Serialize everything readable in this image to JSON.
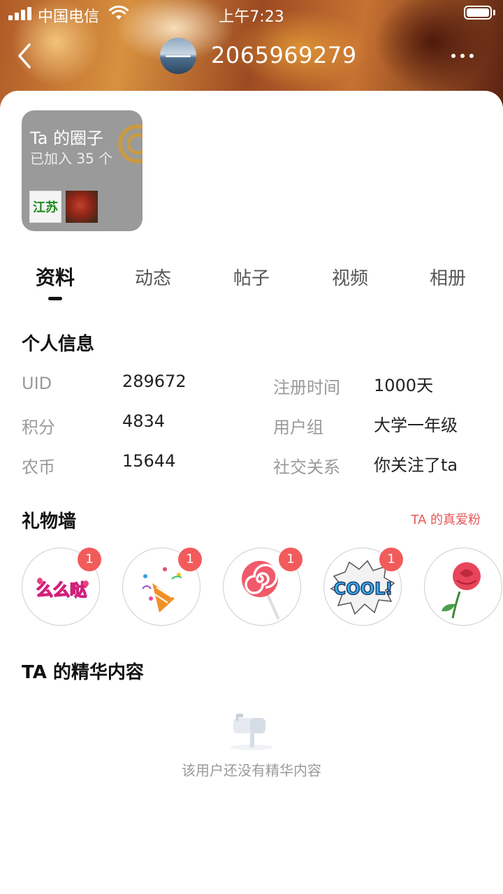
{
  "status_bar": {
    "carrier": "中国电信",
    "time": "上午7:23"
  },
  "header": {
    "title": "2065969279",
    "back_icon": "chevron-left-icon",
    "more_icon": "more-dots-icon"
  },
  "circle": {
    "title": "Ta 的圈子",
    "subtitle": "已加入 35 个",
    "thumbs": [
      {
        "label": "江苏"
      },
      {
        "label": ""
      }
    ]
  },
  "tabs": [
    {
      "label": "资料",
      "active": true
    },
    {
      "label": "动态",
      "active": false
    },
    {
      "label": "帖子",
      "active": false
    },
    {
      "label": "视频",
      "active": false
    },
    {
      "label": "相册",
      "active": false
    }
  ],
  "profile": {
    "section_title": "个人信息",
    "rows": [
      {
        "label": "UID",
        "value": "289672"
      },
      {
        "label": "注册时间",
        "value": "1000天"
      },
      {
        "label": "积分",
        "value": "4834"
      },
      {
        "label": "用户组",
        "value": "大学一年级"
      },
      {
        "label": "农币",
        "value": "15644"
      },
      {
        "label": "社交关系",
        "value": "你关注了ta"
      }
    ]
  },
  "gifts": {
    "section_title": "礼物墙",
    "link": "TA 的真爱粉",
    "items": [
      {
        "name": "kiss-text-gift",
        "count": "1",
        "text": "么么哒"
      },
      {
        "name": "party-popper-gift",
        "count": "1"
      },
      {
        "name": "lollipop-gift",
        "count": "1"
      },
      {
        "name": "cool-sticker-gift",
        "count": "1",
        "text": "COOL!"
      },
      {
        "name": "rose-gift",
        "count": ""
      }
    ]
  },
  "featured": {
    "section_title": "TA 的精华内容",
    "empty_text": "该用户还没有精华内容",
    "empty_icon": "mailbox-icon"
  },
  "colors": {
    "accent": "#e8565a",
    "badge": "#f25b5b"
  }
}
